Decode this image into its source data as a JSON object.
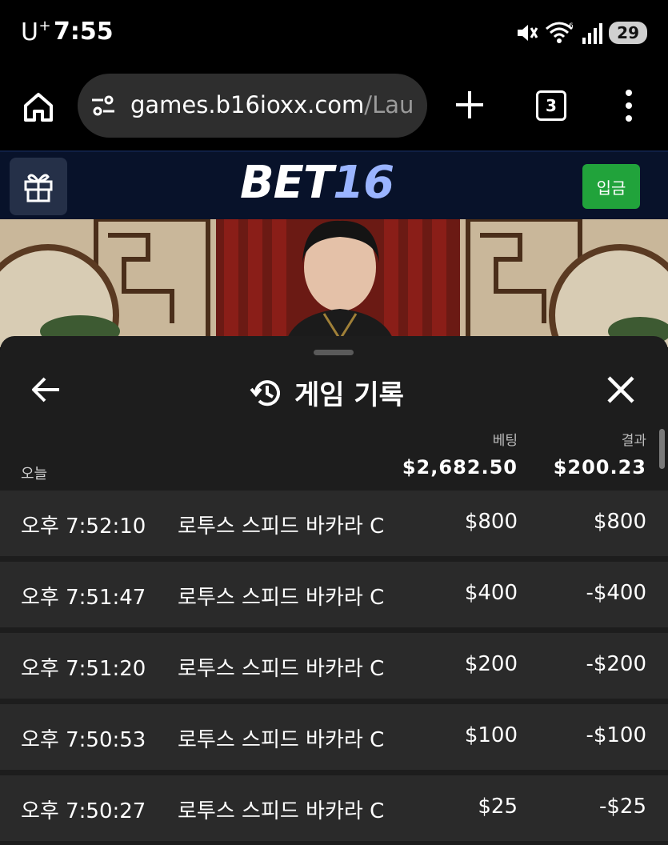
{
  "status_bar": {
    "carrier": "U",
    "carrier_sup": "+",
    "time": "7:55",
    "battery": "29"
  },
  "browser": {
    "url_host": "games.b16ioxx.com",
    "url_path": "/Lau",
    "tab_count": "3"
  },
  "site_header": {
    "logo_part1": "BET",
    "logo_part2": "16",
    "deposit_label": "입금"
  },
  "sheet": {
    "title": "게임 기록",
    "section_label": "오늘",
    "bet_header": "베팅",
    "result_header": "결과",
    "total_bet": "$2,682.50",
    "total_result": "$200.23",
    "rows": [
      {
        "time": "오후 7:52:10",
        "game": "로투스 스피드 바카라 C",
        "bet": "$800",
        "result": "$800"
      },
      {
        "time": "오후 7:51:47",
        "game": "로투스 스피드 바카라 C",
        "bet": "$400",
        "result": "-$400"
      },
      {
        "time": "오후 7:51:20",
        "game": "로투스 스피드 바카라 C",
        "bet": "$200",
        "result": "-$200"
      },
      {
        "time": "오후 7:50:53",
        "game": "로투스 스피드 바카라 C",
        "bet": "$100",
        "result": "-$100"
      },
      {
        "time": "오후 7:50:27",
        "game": "로투스 스피드 바카라 C",
        "bet": "$25",
        "result": "-$25"
      }
    ]
  },
  "colors": {
    "header_bg": "#08122a",
    "deposit_green": "#21a33b",
    "logo_accent": "#9ab4ff",
    "sheet_bg": "#1d1d1d",
    "row_bg": "#2a2a2a"
  }
}
